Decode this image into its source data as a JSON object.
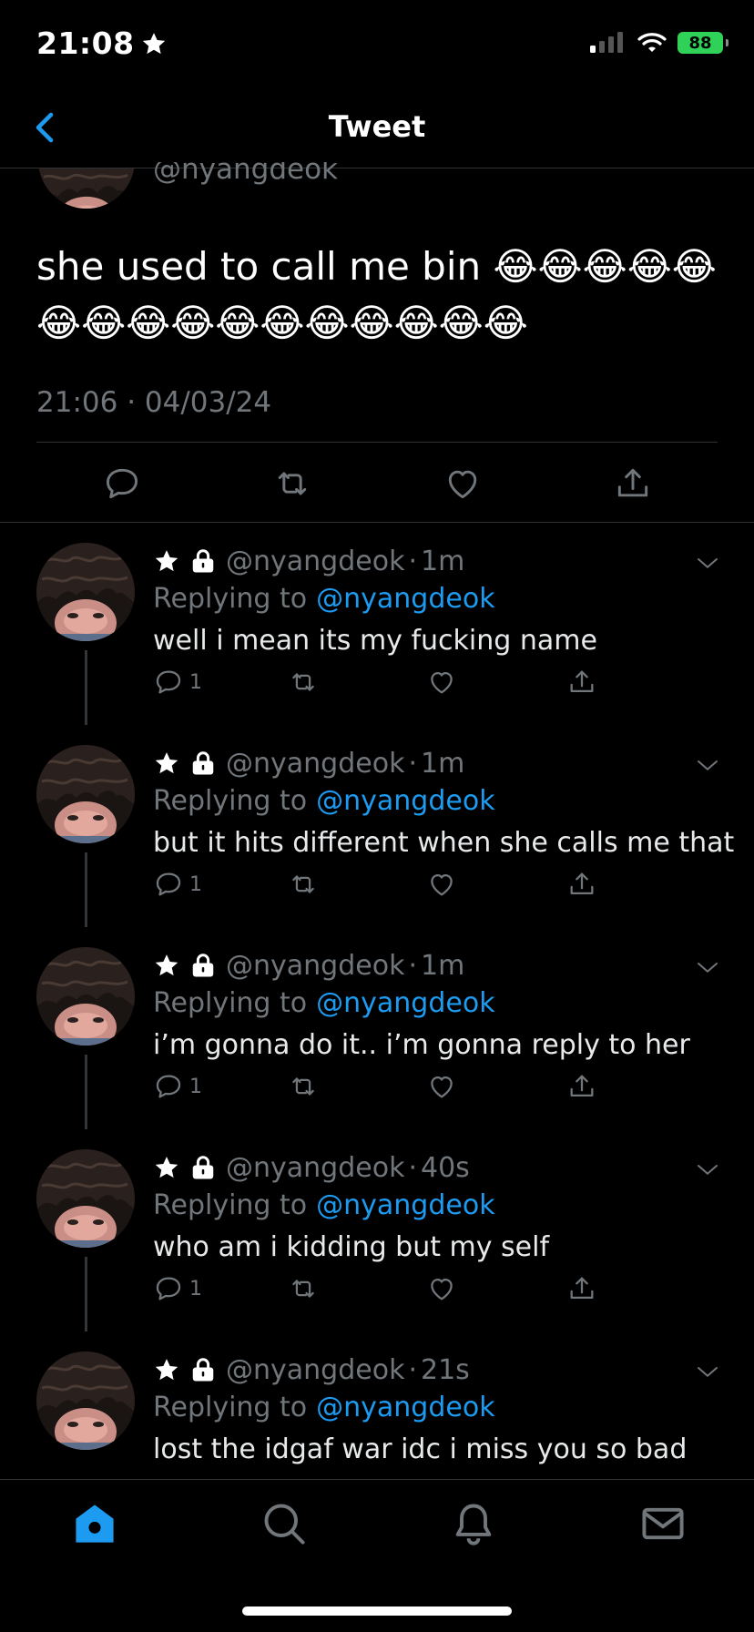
{
  "status_bar": {
    "time": "21:08",
    "battery": "88"
  },
  "nav": {
    "title": "Tweet"
  },
  "main_tweet": {
    "handle": "@nyangdeok",
    "text": "she used to call me bin 😂😂😂😂😂😂😂😂😂😂😂😂😂😂😂😂",
    "timestamp": "21:06 · 04/03/24"
  },
  "replies": [
    {
      "handle": "@nyangdeok",
      "time": "1m",
      "replying_label": "Replying to",
      "replying_to": "@nyangdeok",
      "text": "well i mean its my fucking name",
      "reply_count": "1"
    },
    {
      "handle": "@nyangdeok",
      "time": "1m",
      "replying_label": "Replying to",
      "replying_to": "@nyangdeok",
      "text": "but it hits different when she calls me that",
      "reply_count": "1"
    },
    {
      "handle": "@nyangdeok",
      "time": "1m",
      "replying_label": "Replying to",
      "replying_to": "@nyangdeok",
      "text": "i’m gonna do it.. i’m gonna reply to her",
      "reply_count": "1"
    },
    {
      "handle": "@nyangdeok",
      "time": "40s",
      "replying_label": "Replying to",
      "replying_to": "@nyangdeok",
      "text": "who am i kidding but my self",
      "reply_count": "1"
    },
    {
      "handle": "@nyangdeok",
      "time": "21s",
      "replying_label": "Replying to",
      "replying_to": "@nyangdeok",
      "text": "lost the idgaf war idc i miss you so bad",
      "reply_count": ""
    }
  ],
  "tabs": [
    "home-icon",
    "search-icon",
    "bell-icon",
    "mail-icon"
  ],
  "colors": {
    "accent": "#1d9bf0",
    "muted": "#71767b",
    "battery": "#2fd158"
  }
}
